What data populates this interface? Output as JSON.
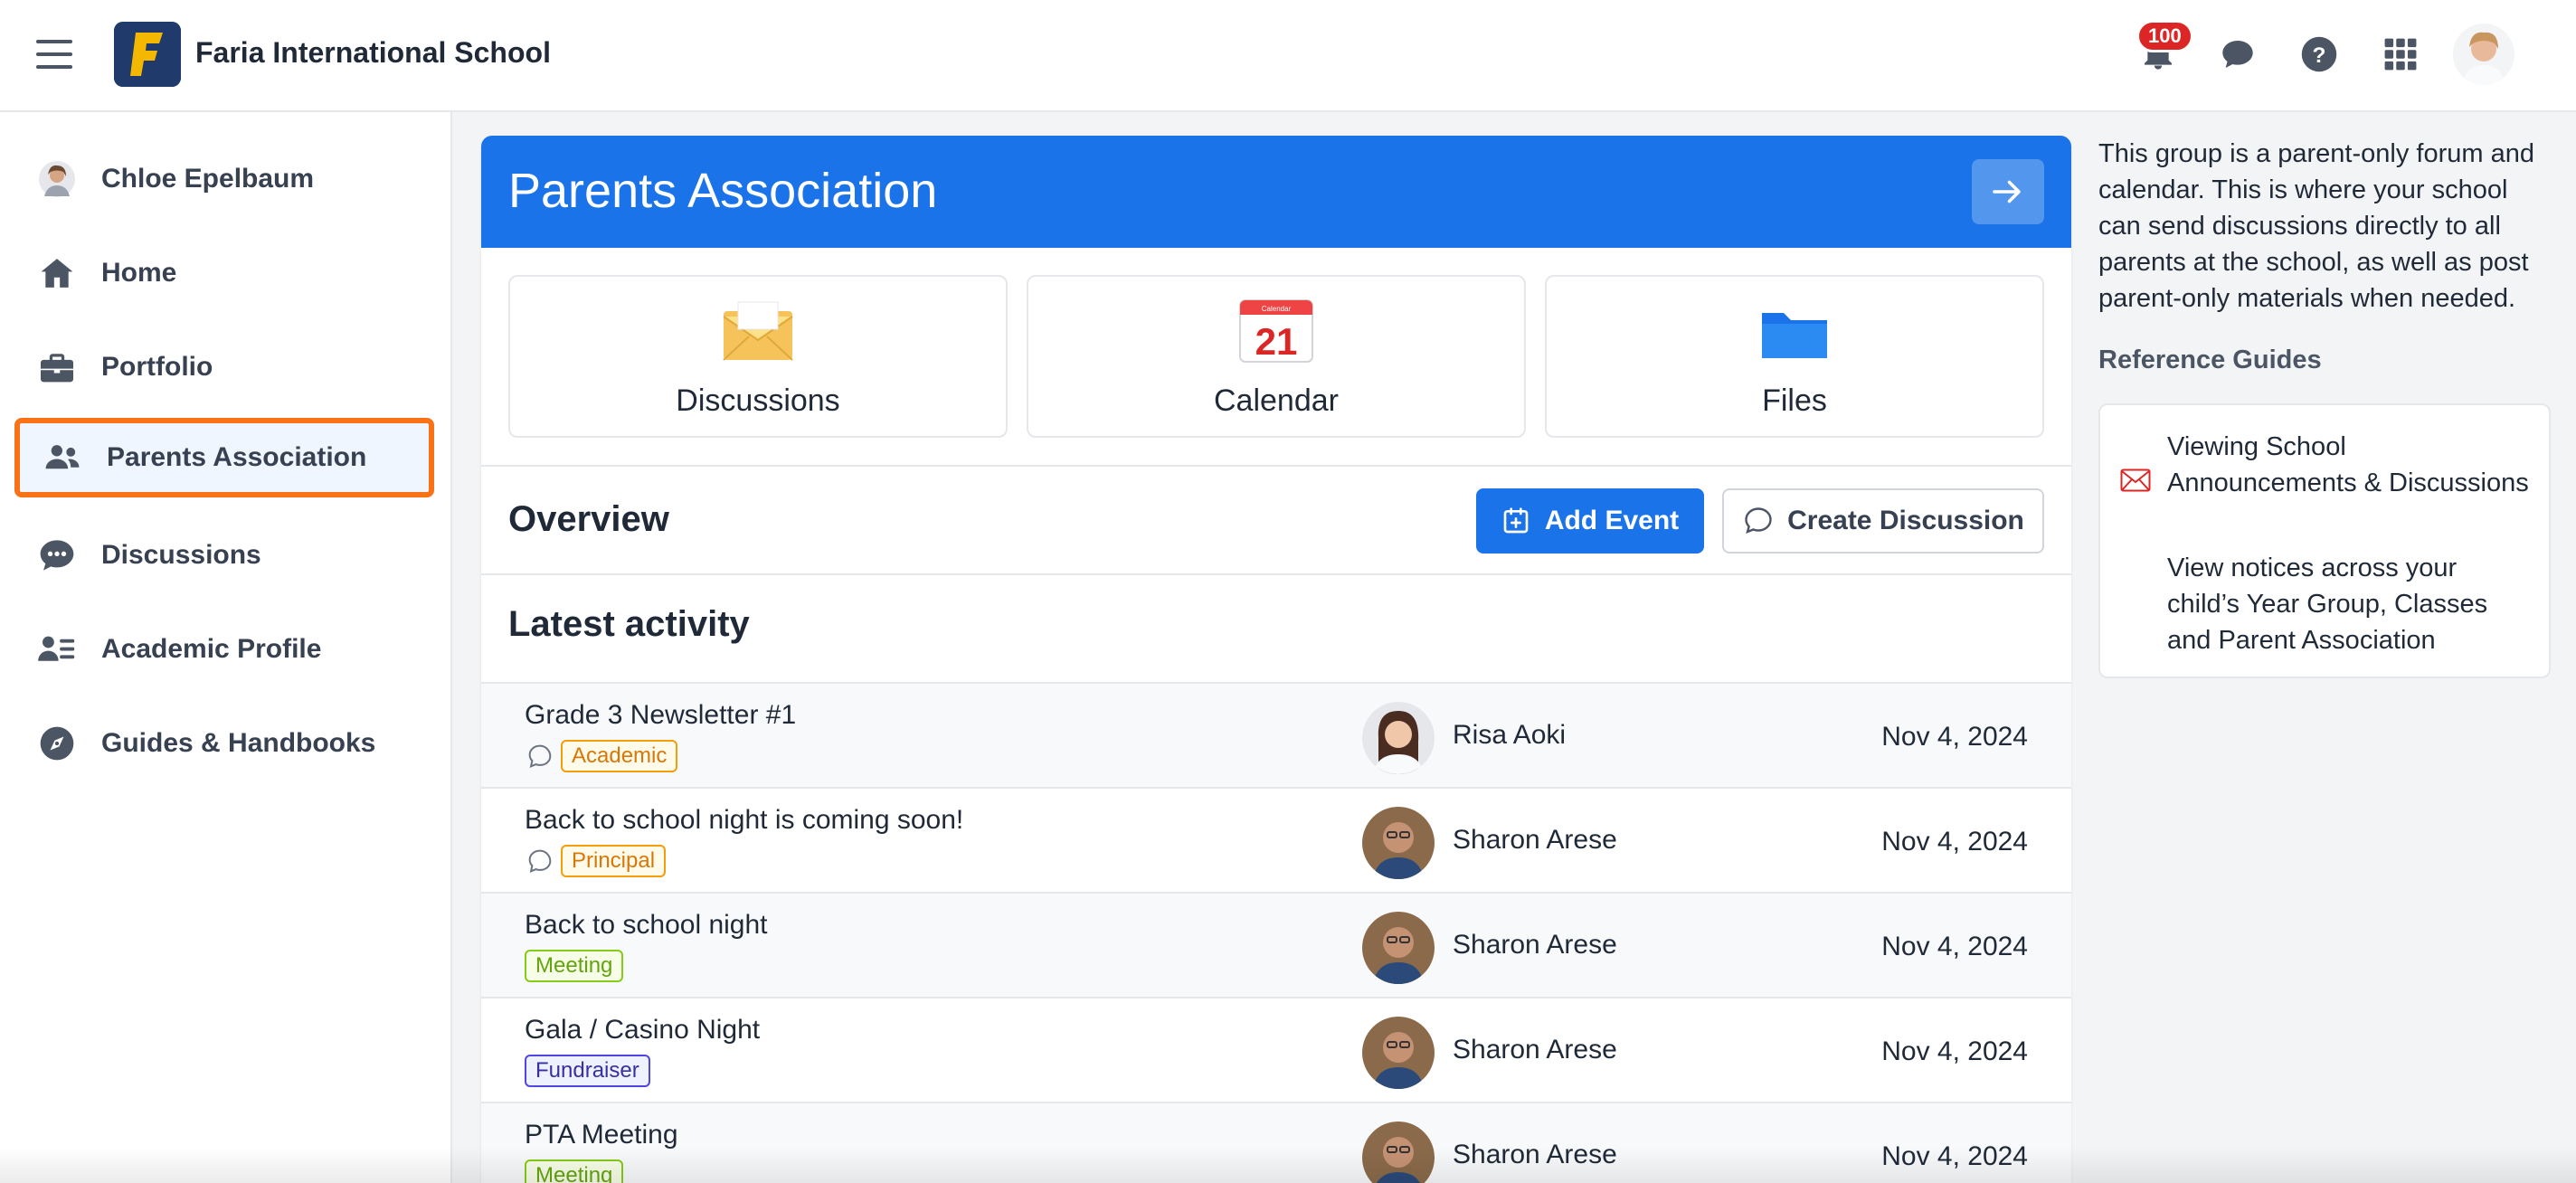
{
  "app": {
    "school_name": "Faria International School",
    "logo_letter": "F",
    "notifications_count": "100"
  },
  "sidebar": {
    "items": [
      {
        "label": "Chloe Epelbaum",
        "icon": "user-avatar"
      },
      {
        "label": "Home",
        "icon": "home-icon"
      },
      {
        "label": "Portfolio",
        "icon": "briefcase-icon"
      },
      {
        "label": "Parents Association",
        "icon": "users-icon",
        "active": true
      },
      {
        "label": "Discussions",
        "icon": "chat-icon"
      },
      {
        "label": "Academic Profile",
        "icon": "id-card-icon"
      },
      {
        "label": "Guides & Handbooks",
        "icon": "compass-icon"
      }
    ]
  },
  "main": {
    "banner_title": "Parents Association",
    "tiles": [
      {
        "label": "Discussions",
        "icon": "envelope-icon"
      },
      {
        "label": "Calendar",
        "icon": "calendar-icon",
        "calendar_day": "21",
        "calendar_header": "Calendar"
      },
      {
        "label": "Files",
        "icon": "folder-icon"
      }
    ],
    "overview_title": "Overview",
    "add_event_label": "Add Event",
    "create_discussion_label": "Create Discussion",
    "latest_title": "Latest activity",
    "activity": [
      {
        "title": "Grade 3 Newsletter #1",
        "tag": "Academic",
        "tag_type": "academic",
        "discussion": true,
        "author": "Risa Aoki",
        "date": "Nov 4, 2024"
      },
      {
        "title": "Back to school night is coming soon!",
        "tag": "Principal",
        "tag_type": "principal",
        "discussion": true,
        "author": "Sharon Arese",
        "date": "Nov 4, 2024"
      },
      {
        "title": "Back to school night",
        "tag": "Meeting",
        "tag_type": "meeting",
        "discussion": false,
        "author": "Sharon Arese",
        "date": "Nov 4, 2024"
      },
      {
        "title": "Gala / Casino Night",
        "tag": "Fundraiser",
        "tag_type": "fundraiser",
        "discussion": false,
        "author": "Sharon Arese",
        "date": "Nov 4, 2024"
      },
      {
        "title": "PTA Meeting",
        "tag": "Meeting",
        "tag_type": "meeting",
        "discussion": false,
        "author": "Sharon Arese",
        "date": "Nov 4, 2024"
      }
    ]
  },
  "right": {
    "about": "This group is a parent-only forum and calendar. This is where your school can send discussions directly to all parents at the school, as well as post parent-only materials when needed.",
    "reference_title": "Reference Guides",
    "guide_link": "Viewing School Announcements & Discussions",
    "guide_desc": "View notices across your child’s Year Group, Classes and Parent Association"
  },
  "colors": {
    "brand_blue": "#1a73e8",
    "active_outline": "#f97316",
    "badge_red": "#dc2626"
  }
}
